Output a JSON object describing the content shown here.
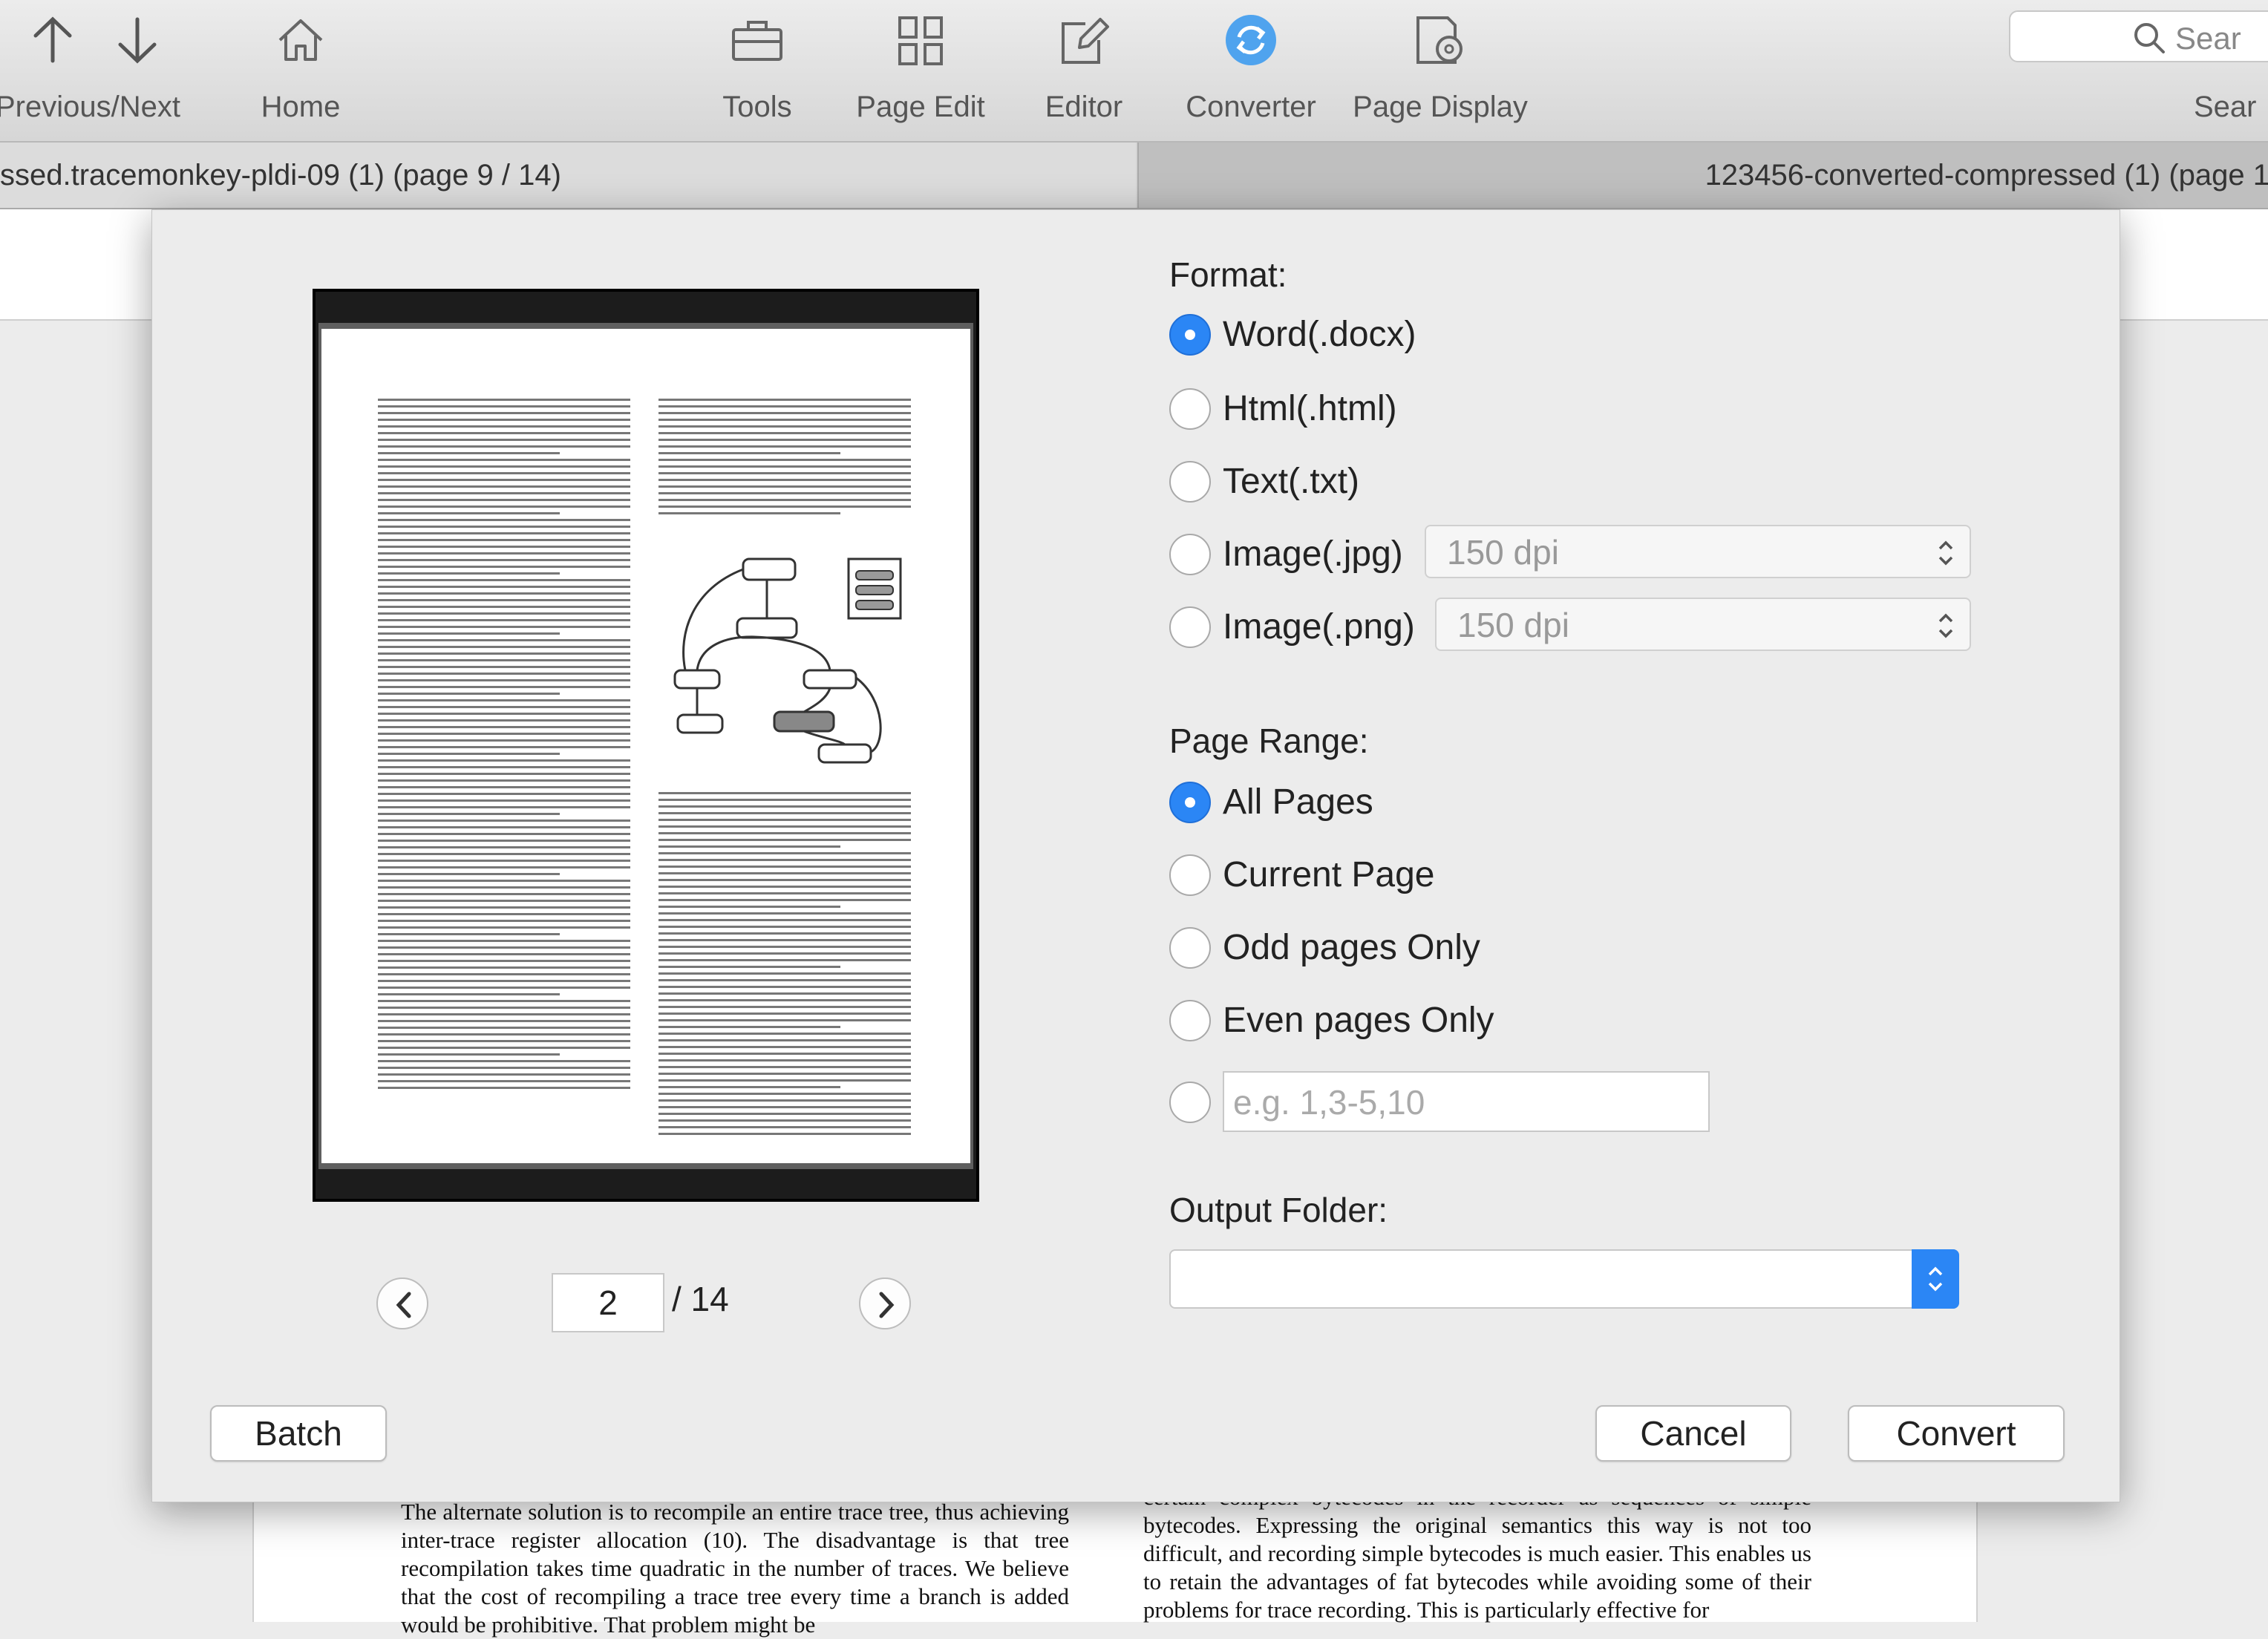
{
  "toolbar": {
    "previous_next_label": "Previous/Next",
    "home_label": "Home",
    "tools_label": "Tools",
    "page_edit_label": "Page Edit",
    "editor_label": "Editor",
    "converter_label": "Converter",
    "page_display_label": "Page Display",
    "search_placeholder": "Sear",
    "search_label": "Sear"
  },
  "tabs": [
    {
      "label": "ssed.tracemonkey-pldi-09 (1) (page 9 / 14)"
    },
    {
      "label": "123456-converted-compressed (1) (page 1"
    }
  ],
  "dialog": {
    "format_label": "Format:",
    "formats": [
      {
        "label": "Word(.docx)",
        "selected": true
      },
      {
        "label": "Html(.html)",
        "selected": false
      },
      {
        "label": "Text(.txt)",
        "selected": false
      },
      {
        "label": "Image(.jpg)",
        "selected": false,
        "dpi": "150 dpi"
      },
      {
        "label": "Image(.png)",
        "selected": false,
        "dpi": "150 dpi"
      }
    ],
    "page_range_label": "Page Range:",
    "ranges": [
      {
        "label": "All Pages",
        "selected": true
      },
      {
        "label": "Current Page",
        "selected": false
      },
      {
        "label": "Odd pages Only",
        "selected": false
      },
      {
        "label": "Even pages Only",
        "selected": false
      }
    ],
    "custom_range_placeholder": "e.g. 1,3-5,10",
    "output_folder_label": "Output Folder:",
    "output_folder_value": "",
    "current_page": "2",
    "total_pages": "/ 14",
    "batch_label": "Batch",
    "cancel_label": "Cancel",
    "convert_label": "Convert"
  },
  "document": {
    "left_text": "The alternate solution is to recompile an entire trace tree, thus achieving inter-trace register allocation (10). The disadvantage is that tree recompilation takes time quadratic in the number of traces. We believe that the cost of recompiling a trace tree every time a branch is added would be prohibitive. That problem might be",
    "right_text": "certain complex bytecodes in the recorder as sequences of simple bytecodes. Expressing the original semantics this way is not too difficult, and recording simple bytecodes is much easier. This enables us to retain the advantages of fat bytecodes while avoiding some of their problems for trace recording. This is particularly effective for"
  },
  "colors": {
    "accent": "#2b86f5",
    "dialog_bg": "#ececec",
    "toolbar_bg": "#dcdcdc"
  }
}
